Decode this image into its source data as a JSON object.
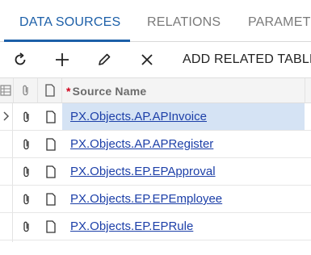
{
  "tabs": [
    {
      "label": "DATA SOURCES",
      "active": true
    },
    {
      "label": "RELATIONS",
      "active": false
    },
    {
      "label": "PARAMETE",
      "active": false
    }
  ],
  "toolbar": {
    "refresh_icon": "refresh-icon",
    "add_icon": "plus-icon",
    "edit_icon": "pencil-icon",
    "delete_icon": "close-icon",
    "add_related_label": "ADD RELATED TABLE"
  },
  "grid": {
    "header": {
      "required_mark": "*",
      "source_name_label": "Source Name"
    },
    "rows": [
      {
        "name": "PX.Objects.AP.APInvoice",
        "selected": true
      },
      {
        "name": "PX.Objects.AP.APRegister",
        "selected": false
      },
      {
        "name": "PX.Objects.EP.EPApproval",
        "selected": false
      },
      {
        "name": "PX.Objects.EP.EPEmployee",
        "selected": false
      },
      {
        "name": "PX.Objects.EP.EPRule",
        "selected": false
      }
    ]
  },
  "colors": {
    "accent": "#1c5fa8",
    "link": "#1c3fa8",
    "selected_row": "#d5e3f4",
    "required": "#d0021b"
  }
}
